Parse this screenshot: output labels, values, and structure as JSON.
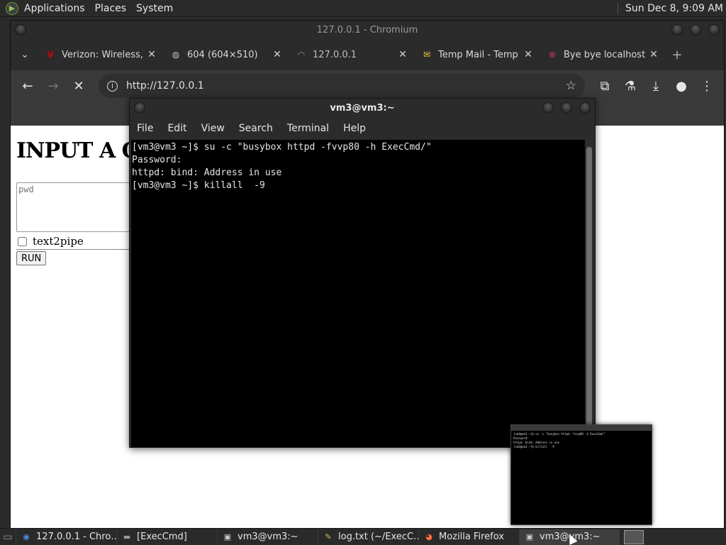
{
  "top_panel": {
    "menu_items": [
      "Applications",
      "Places",
      "System"
    ],
    "clock": "Sun Dec  8,  9:09 AM"
  },
  "chromium": {
    "window_title": "127.0.0.1 - Chromium",
    "tabs": [
      {
        "title": "Verizon: Wireless,",
        "icon": "verizon-logo-icon",
        "color": "#cd040b"
      },
      {
        "title": "604 (604×510)",
        "icon": "globe-icon",
        "color": "#bdbdbd"
      },
      {
        "title": "127.0.0.1",
        "icon": "loading-spinner-icon",
        "color": "#8a8a8a"
      },
      {
        "title": "Temp Mail - Temp",
        "icon": "mail-icon",
        "color": "#f5c242"
      },
      {
        "title": "Bye bye localhost",
        "icon": "bye-icon",
        "color": "#d6336c"
      }
    ],
    "new_tab": "+",
    "url": "http://127.0.0.1"
  },
  "page": {
    "heading": "INPUT A C",
    "textarea_placeholder": "pwd",
    "checkbox_label": "text2pipe",
    "run_label": "RUN"
  },
  "terminal": {
    "title": "vm3@vm3:~",
    "menu": [
      "File",
      "Edit",
      "View",
      "Search",
      "Terminal",
      "Help"
    ],
    "lines": [
      "[vm3@vm3 ~]$ su -c \"busybox httpd -fvvp80 -h ExecCmd/\"",
      "Password:",
      "httpd: bind: Address in use",
      "[vm3@vm3 ~]$ killall  -9"
    ]
  },
  "taskbar": {
    "tasks": [
      {
        "label": "127.0.0.1 - Chro…",
        "icon": "chromium-icon"
      },
      {
        "label": "[ExecCmd]",
        "icon": "folder-icon"
      },
      {
        "label": "vm3@vm3:~",
        "icon": "terminal-icon"
      },
      {
        "label": "log.txt (~/ExecC…",
        "icon": "text-editor-icon"
      },
      {
        "label": "Mozilla Firefox",
        "icon": "firefox-icon"
      },
      {
        "label": "vm3@vm3:~",
        "icon": "terminal-icon"
      }
    ]
  }
}
